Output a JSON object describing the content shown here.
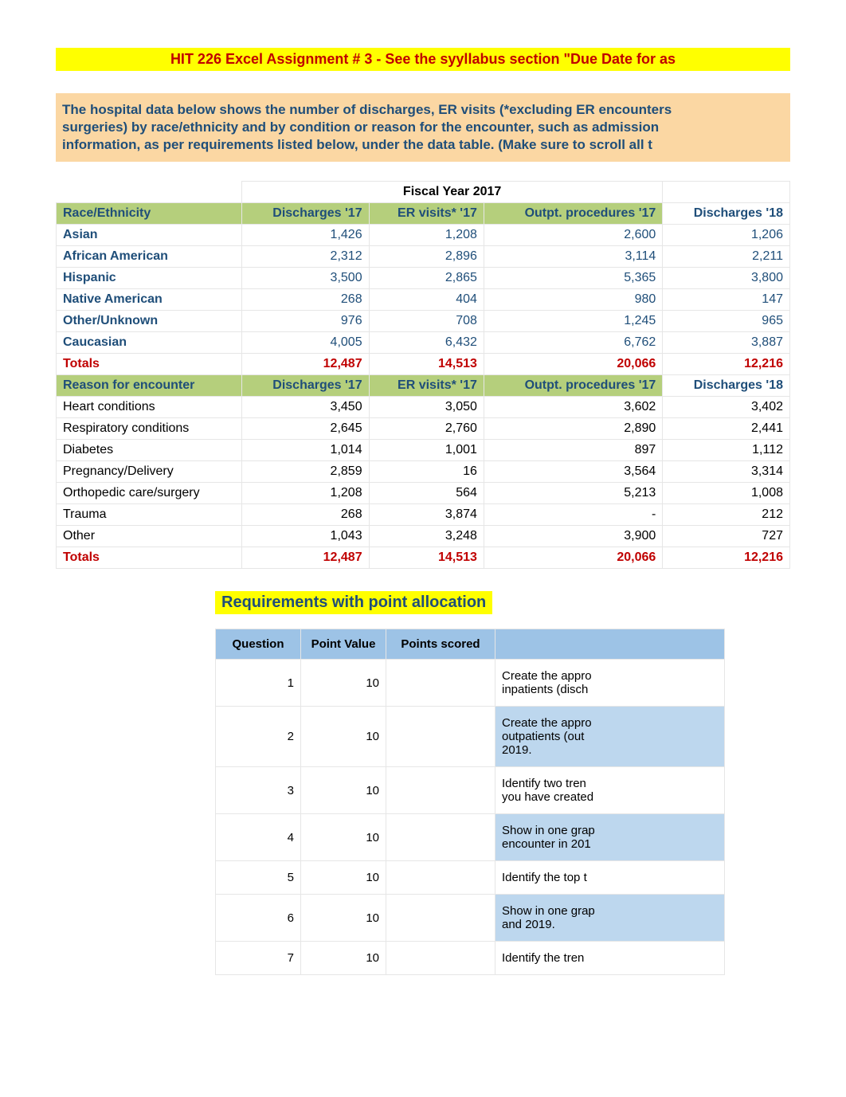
{
  "title": "HIT 226 Excel Assignment # 3 - See the syyllabus section \"Due Date for as",
  "intro_line1": "The hospital data below shows the number of discharges, ER visits (*excluding ER encounters",
  "intro_line2": "surgeries) by race/ethnicity and by condition or reason for the encounter, such as admission",
  "intro_line3a": "information, as per requirements listed below, under the data table.  ",
  "intro_line3b": "(Make sure to scroll all t",
  "fy_header": "Fiscal Year 2017",
  "cols": {
    "c1": "Discharges '17",
    "c2": "ER visits* '17",
    "c3": "Outpt. procedures '17",
    "c4": "Discharges '18"
  },
  "section1_label": "Race/Ethnicity",
  "race_rows": [
    {
      "name": "Asian",
      "d17": "1,426",
      "er17": "1,208",
      "op17": "2,600",
      "d18": "1,206"
    },
    {
      "name": "African American",
      "d17": "2,312",
      "er17": "2,896",
      "op17": "3,114",
      "d18": "2,211"
    },
    {
      "name": "Hispanic",
      "d17": "3,500",
      "er17": "2,865",
      "op17": "5,365",
      "d18": "3,800"
    },
    {
      "name": "Native American",
      "d17": "268",
      "er17": "404",
      "op17": "980",
      "d18": "147"
    },
    {
      "name": "Other/Unknown",
      "d17": "976",
      "er17": "708",
      "op17": "1,245",
      "d18": "965"
    },
    {
      "name": "Caucasian",
      "d17": "4,005",
      "er17": "6,432",
      "op17": "6,762",
      "d18": "3,887"
    }
  ],
  "totals1": {
    "label": "Totals",
    "d17": "12,487",
    "er17": "14,513",
    "op17": "20,066",
    "d18": "12,216"
  },
  "section2_label": "Reason for encounter",
  "reason_rows": [
    {
      "name": "Heart conditions",
      "d17": "3,450",
      "er17": "3,050",
      "op17": "3,602",
      "d18": "3,402"
    },
    {
      "name": "Respiratory conditions",
      "d17": "2,645",
      "er17": "2,760",
      "op17": "2,890",
      "d18": "2,441"
    },
    {
      "name": "Diabetes",
      "d17": "1,014",
      "er17": "1,001",
      "op17": "897",
      "d18": "1,112"
    },
    {
      "name": "Pregnancy/Delivery",
      "d17": "2,859",
      "er17": "16",
      "op17": "3,564",
      "d18": "3,314"
    },
    {
      "name": "Orthopedic care/surgery",
      "d17": "1,208",
      "er17": "564",
      "op17": "5,213",
      "d18": "1,008"
    },
    {
      "name": "Trauma",
      "d17": "268",
      "er17": "3,874",
      "op17": "-",
      "d18": "212"
    },
    {
      "name": "Other",
      "d17": "1,043",
      "er17": "3,248",
      "op17": "3,900",
      "d18": "727"
    }
  ],
  "totals2": {
    "label": "Totals",
    "d17": "12,487",
    "er17": "14,513",
    "op17": "20,066",
    "d18": "12,216"
  },
  "req_title": "Requirements with point allocation",
  "req_headers": {
    "q": "Question",
    "pv": "Point Value",
    "ps": "Points scored",
    "desc": ""
  },
  "req_rows": [
    {
      "q": "1",
      "pv": "10",
      "ps": "",
      "desc": "Create the appro\ninpatients (disch"
    },
    {
      "q": "2",
      "pv": "10",
      "ps": "",
      "desc": "Create the appro\noutpatients (out\n2019."
    },
    {
      "q": "3",
      "pv": "10",
      "ps": "",
      "desc": "Identify two tren\nyou have created"
    },
    {
      "q": "4",
      "pv": "10",
      "ps": "",
      "desc": "Show in one grap\nencounter in 201"
    },
    {
      "q": "5",
      "pv": "10",
      "ps": "",
      "desc": "Identify the top t"
    },
    {
      "q": "6",
      "pv": "10",
      "ps": "",
      "desc": "Show in one grap\nand 2019."
    },
    {
      "q": "7",
      "pv": "10",
      "ps": "",
      "desc": "Identify the tren"
    }
  ]
}
